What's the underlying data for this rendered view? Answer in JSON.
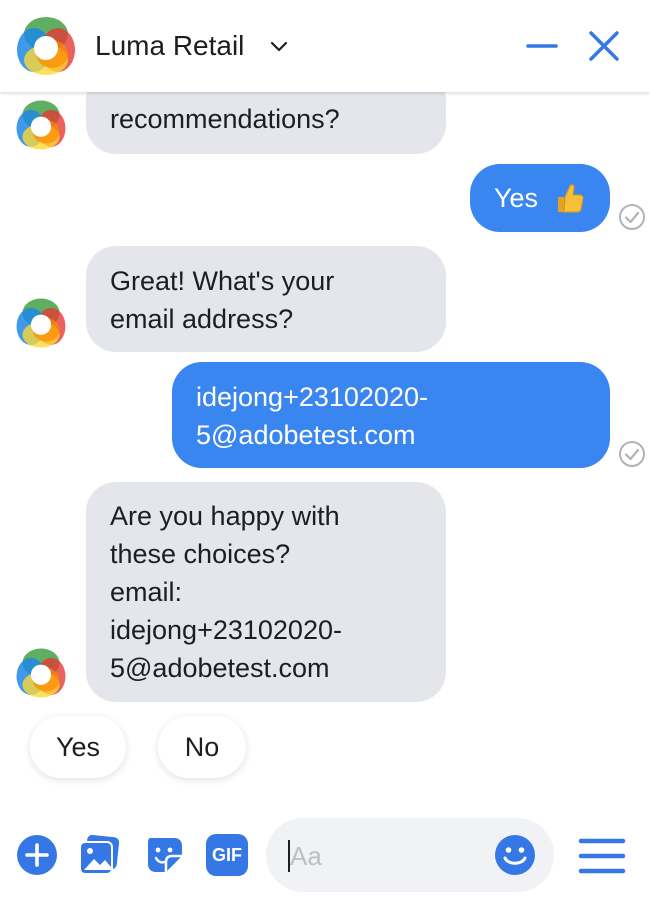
{
  "header": {
    "title": "Luma Retail",
    "accent_color": "#3578e5"
  },
  "messages": [
    {
      "from": "bot",
      "lines": [
        "recommendations?"
      ]
    },
    {
      "from": "user",
      "text": "Yes",
      "emoji": "thumbs-up"
    },
    {
      "from": "bot",
      "lines": [
        "Great! What's your",
        "email address?"
      ]
    },
    {
      "from": "user",
      "lines": [
        "idejong+23102020-",
        "5@adobetest.com"
      ]
    },
    {
      "from": "bot",
      "lines": [
        "Are you happy with",
        "these choices?",
        "email:",
        "idejong+23102020-",
        "5@adobetest.com"
      ]
    }
  ],
  "quick_replies": [
    "Yes",
    "No"
  ],
  "composer": {
    "placeholder": "Aa",
    "icons": [
      "plus-icon",
      "image-icon",
      "sticker-icon",
      "gif-icon",
      "emoji-icon",
      "menu-icon"
    ],
    "gif_label": "GIF"
  },
  "colors": {
    "bot_bubble": "#e4e6eb",
    "user_bubble": "#3a86f0",
    "accent": "#3578e5"
  }
}
